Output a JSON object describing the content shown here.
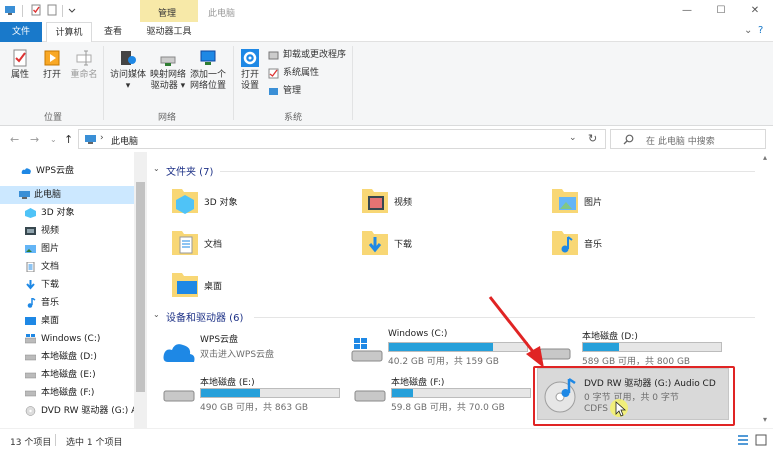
{
  "window": {
    "context_tab": "管理",
    "title": "此电脑"
  },
  "ribbon_tabs": [
    "文件",
    "计算机",
    "查看",
    "驱动器工具"
  ],
  "ribbon": {
    "location": {
      "label": "位置",
      "properties": "属性",
      "open": "打开",
      "rename": "重命名"
    },
    "network": {
      "label": "网络",
      "access_media_1": "访问媒体",
      "map_drive_1": "映射网络",
      "map_drive_2": "驱动器",
      "add_location_1": "添加一个",
      "add_location_2": "网络位置"
    },
    "system": {
      "label": "系统",
      "open_settings_1": "打开",
      "open_settings_2": "设置",
      "uninstall": "卸载或更改程序",
      "sys_props": "系统属性",
      "manage": "管理"
    }
  },
  "address": {
    "path": "此电脑",
    "search_placeholder": "在 此电脑 中搜索"
  },
  "sidebar": {
    "items": [
      {
        "label": "WPS云盘",
        "icon": "cloud-icon"
      },
      {
        "label": "此电脑",
        "icon": "computer-icon"
      },
      {
        "label": "3D 对象",
        "icon": "cube-icon"
      },
      {
        "label": "视频",
        "icon": "video-icon"
      },
      {
        "label": "图片",
        "icon": "picture-icon"
      },
      {
        "label": "文档",
        "icon": "document-icon"
      },
      {
        "label": "下载",
        "icon": "download-icon"
      },
      {
        "label": "音乐",
        "icon": "music-icon"
      },
      {
        "label": "桌面",
        "icon": "desktop-icon"
      },
      {
        "label": "Windows (C:)",
        "icon": "windows-drive-icon"
      },
      {
        "label": "本地磁盘 (D:)",
        "icon": "drive-icon"
      },
      {
        "label": "本地磁盘 (E:)",
        "icon": "drive-icon"
      },
      {
        "label": "本地磁盘 (F:)",
        "icon": "drive-icon"
      },
      {
        "label": "DVD RW 驱动器 (G:) A",
        "icon": "dvd-icon"
      }
    ]
  },
  "folders_section": {
    "title": "文件夹 (7)",
    "items": [
      "3D 对象",
      "视频",
      "图片",
      "文档",
      "下载",
      "音乐",
      "桌面"
    ]
  },
  "drives_section": {
    "title": "设备和驱动器 (6)",
    "items": [
      {
        "name": "WPS云盘",
        "sub": "双击进入WPS云盘",
        "fill": null
      },
      {
        "name": "Windows (C:)",
        "sub": "40.2 GB 可用，共 159 GB",
        "fill": 0.75
      },
      {
        "name": "本地磁盘 (D:)",
        "sub": "589 GB 可用，共 800 GB",
        "fill": 0.26
      },
      {
        "name": "本地磁盘 (E:)",
        "sub": "490 GB 可用，共 863 GB",
        "fill": 0.43
      },
      {
        "name": "本地磁盘 (F:)",
        "sub": "59.8 GB 可用，共 70.0 GB",
        "fill": 0.15
      },
      {
        "name": "DVD RW 驱动器 (G:) Audio CD",
        "sub": "0 字节 可用，共 0 字节",
        "sub2": "CDFS",
        "fill": null
      }
    ]
  },
  "status": {
    "count": "13 个项目",
    "selected": "选中 1 个项目"
  },
  "colors": {
    "accent": "#1979ca",
    "drive_fill": "#26a0da",
    "highlight": "#e02424"
  }
}
